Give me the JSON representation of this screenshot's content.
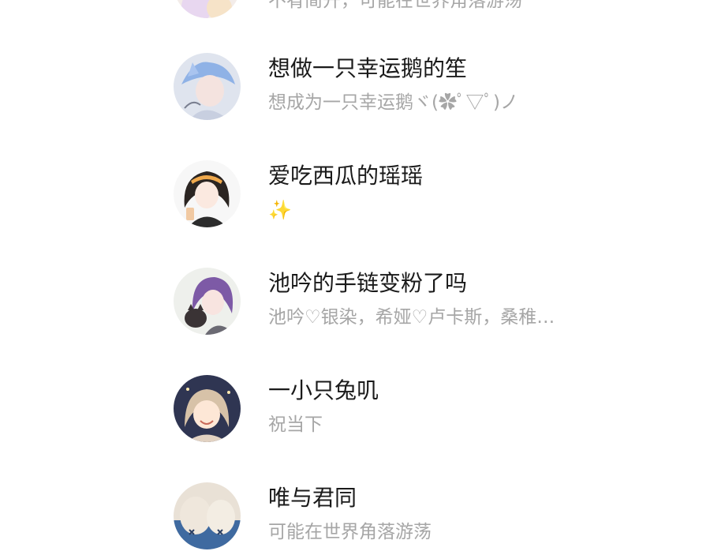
{
  "friends": [
    {
      "name": "",
      "signature": "不宥简开，可能在世界角落游荡"
    },
    {
      "name": "想做一只幸运鹅的笙",
      "signature": "想成为一只幸运鹅ヾ(✿ﾟ▽ﾟ)ノ"
    },
    {
      "name": "爱吃西瓜的瑶瑶",
      "signature": "✨"
    },
    {
      "name": "池吟的手链变粉了吗",
      "signature": "池吟♡银染，希娅♡卢卡斯，桑稚…"
    },
    {
      "name": "一小只兔叽",
      "signature": "祝当下"
    },
    {
      "name": "唯与君同",
      "signature": "可能在世界角落游荡"
    }
  ],
  "colors": {
    "name_text": "#1a1a1a",
    "signature_text": "#a6a6a6",
    "background": "#ffffff"
  }
}
